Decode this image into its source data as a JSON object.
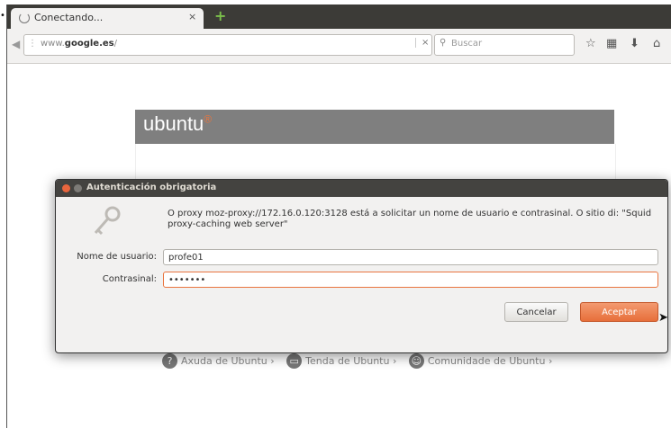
{
  "browser": {
    "tab_title": "Conectando...",
    "tab_close": "×",
    "new_tab_icon": "+",
    "url_prefix": "www.",
    "url_domain": "google.es",
    "url_suffix": "/",
    "url_clear": "×",
    "search_placeholder": "Buscar"
  },
  "page": {
    "logo_text": "ubuntu",
    "logo_mark": "®",
    "links": [
      {
        "label": "Axuda de Ubuntu ›",
        "icon": "?"
      },
      {
        "label": "Tenda de Ubuntu ›",
        "icon": "▭"
      },
      {
        "label": "Comunidade de Ubuntu ›",
        "icon": "☺"
      }
    ]
  },
  "dialog": {
    "title": "Autenticación obrigatoria",
    "message": "O proxy moz-proxy://172.16.0.120:3128 está a solicitar un nome de usuario e contrasinal. O sitio di: \"Squid proxy-caching web server\"",
    "username_label": "Nome de usuario:",
    "username_value": "profe01",
    "password_label": "Contrasinal:",
    "password_value": "•••••••",
    "cancel_label": "Cancelar",
    "ok_label": "Aceptar"
  },
  "colors": {
    "accent": "#e9753f",
    "titlebar": "#3c3b37"
  }
}
